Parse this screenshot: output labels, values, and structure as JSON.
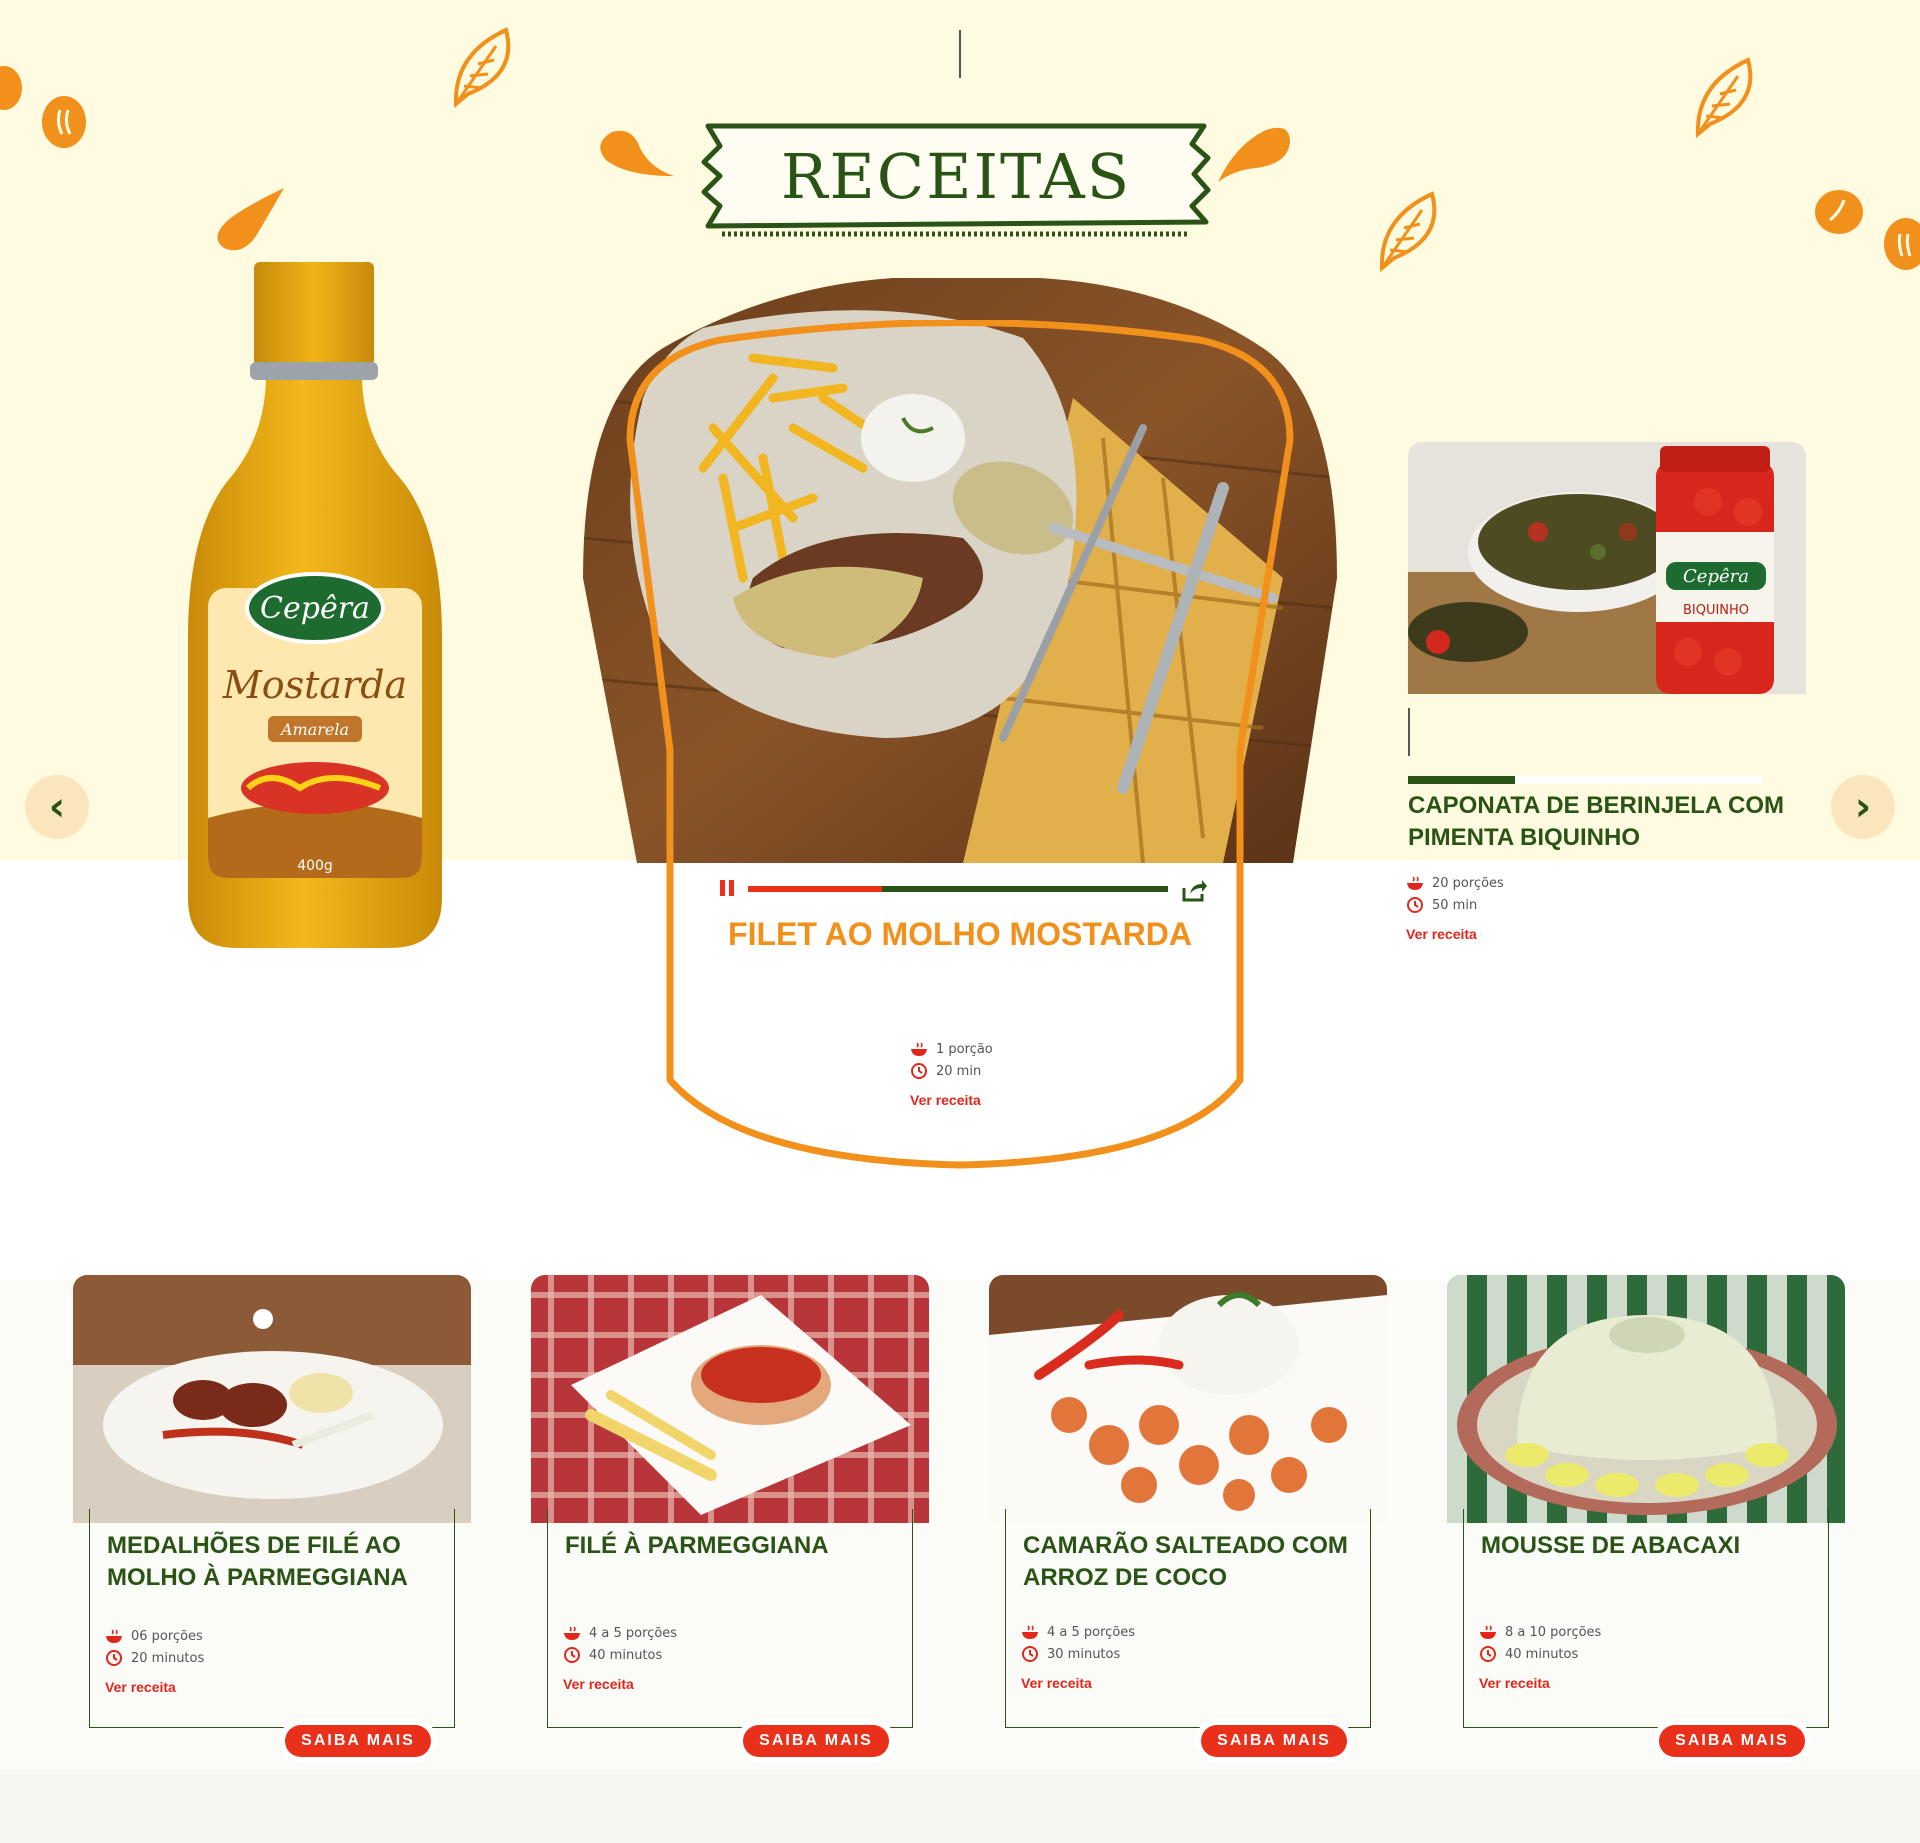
{
  "colors": {
    "accent_orange": "#f2901c",
    "brand_green": "#2a5416",
    "red": "#e8301b",
    "cream": "#fffbe0"
  },
  "header": {
    "title": "RECEITAS"
  },
  "nav": {
    "prev_icon": "chevron-left-icon",
    "next_icon": "chevron-right-icon",
    "prev_glyph": "‹",
    "next_glyph": "›"
  },
  "product": {
    "brand": "Cepêra",
    "name": "Mostarda",
    "variant": "Amarela",
    "net_weight": "400g"
  },
  "side_product": {
    "brand": "Cepêra",
    "name": "BIQUINHO"
  },
  "featured": {
    "title": "FILET AO MOLHO MOSTARDA",
    "servings": "1 porção",
    "time": "20 min",
    "link": "Ver receita",
    "video_progress": 0.32
  },
  "side": {
    "title": "CAPONATA DE BERINJELA COM PIMENTA BIQUINHO",
    "servings": "20 porções",
    "time": "50 min",
    "link": "Ver receita",
    "progress": 0.3
  },
  "cards": [
    {
      "title": "MEDALHÕES DE FILÉ AO MOLHO À PARMEGGIANA",
      "servings": "06 porções",
      "time": "20 minutos",
      "link": "Ver receita",
      "button": "SAIBA MAIS"
    },
    {
      "title": "FILÉ À PARMEGGIANA",
      "servings": "4 a 5 porções",
      "time": "40 minutos",
      "link": "Ver receita",
      "button": "SAIBA MAIS"
    },
    {
      "title": "CAMARÃO SALTEADO COM ARROZ DE COCO",
      "servings": "4 a 5 porções",
      "time": "30 minutos",
      "link": "Ver receita",
      "button": "SAIBA MAIS"
    },
    {
      "title": "MOUSSE DE ABACAXI",
      "servings": "8 a 10 porções",
      "time": "40 minutos",
      "link": "Ver receita",
      "button": "SAIBA MAIS"
    }
  ]
}
